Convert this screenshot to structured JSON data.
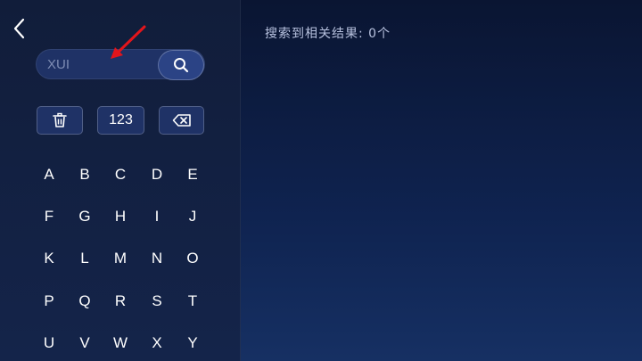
{
  "search": {
    "placeholder": "XUI"
  },
  "function_keys": {
    "numbers_label": "123"
  },
  "keyboard": {
    "rows": [
      [
        "A",
        "B",
        "C",
        "D",
        "E"
      ],
      [
        "F",
        "G",
        "H",
        "I",
        "J"
      ],
      [
        "K",
        "L",
        "M",
        "N",
        "O"
      ],
      [
        "P",
        "Q",
        "R",
        "S",
        "T"
      ],
      [
        "U",
        "V",
        "W",
        "X",
        "Y"
      ]
    ]
  },
  "results": {
    "summary": "搜索到相关结果: 0个"
  },
  "icons": {
    "back": "chevron-left-icon",
    "search": "search-icon",
    "delete_all": "trash-icon",
    "backspace": "backspace-icon"
  },
  "colors": {
    "annotation_arrow": "#e3151b"
  }
}
